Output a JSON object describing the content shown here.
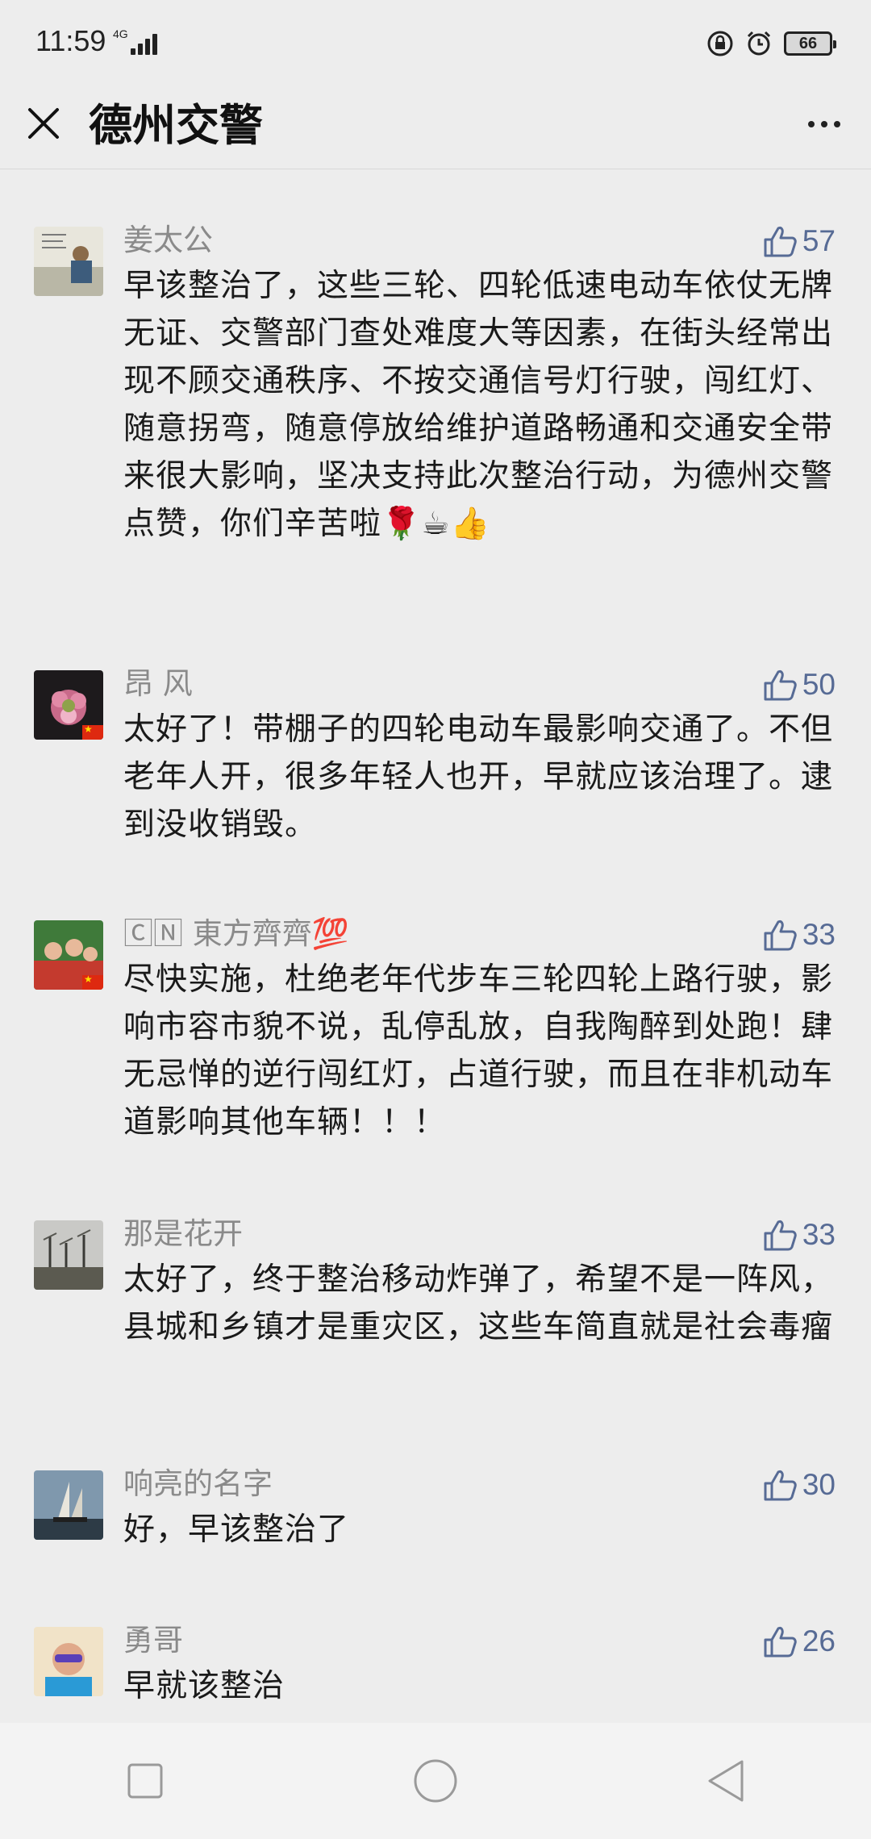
{
  "status_bar": {
    "time": "11:59",
    "network": "4G",
    "battery": "66"
  },
  "header": {
    "title": "德州交警"
  },
  "comments": [
    {
      "name": "姜太公",
      "likes": "57",
      "text": "早该整治了，这些三轮、四轮低速电动车依仗无牌无证、交警部门查处难度大等因素，在街头经常出现不顾交通秩序、不按交通信号灯行驶，闯红灯、随意拐弯，随意停放给维护道路畅通和交通安全带来很大影响，坚决支持此次整治行动，为德州交警点赞，你们辛苦啦🌹☕👍"
    },
    {
      "name": "昂 风",
      "likes": "50",
      "text": "太好了！带棚子的四轮电动车最影响交通了。不但老年人开，很多年轻人也开，早就应该治理了。逮到没收销毁。"
    },
    {
      "name": "🄲🄽 東方齊齊💯",
      "likes": "33",
      "text": "尽快实施，杜绝老年代步车三轮四轮上路行驶，影响市容市貌不说，乱停乱放，自我陶醉到处跑！肆无忌惮的逆行闯红灯，占道行驶，而且在非机动车道影响其他车辆！！！"
    },
    {
      "name": "那是花开",
      "likes": "33",
      "text": "太好了，终于整治移动炸弹了，希望不是一阵风，县城和乡镇才是重灾区，这些车简直就是社会毒瘤"
    },
    {
      "name": "响亮的名字",
      "likes": "30",
      "text": "好，早该整治了"
    },
    {
      "name": "勇哥",
      "likes": "26",
      "text": "早就该整治"
    }
  ],
  "colors": {
    "accent": "#576b95",
    "background": "#ededed"
  }
}
